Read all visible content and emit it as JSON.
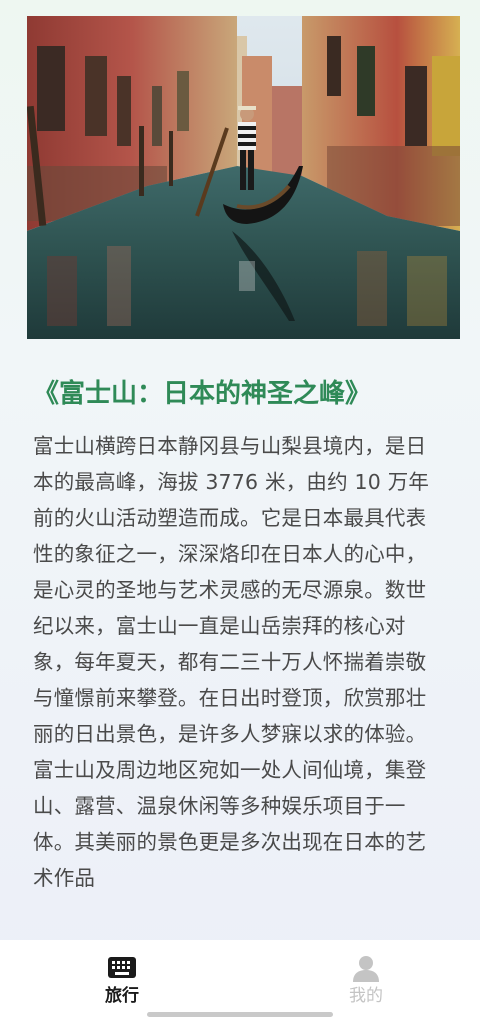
{
  "article": {
    "image_alt": "Venice canal with gondolier",
    "title": "《富士山：日本的神圣之峰》",
    "body": "富士山横跨日本静冈县与山梨县境内，是日本的最高峰，海拔 3776 米，由约 10 万年前的火山活动塑造而成。它是日本最具代表性的象征之一，深深烙印在日本人的心中，是心灵的圣地与艺术灵感的无尽源泉。数世纪以来，富士山一直是山岳崇拜的核心对象，每年夏天，都有二三十万人怀揣着崇敬与憧憬前来攀登。在日出时登顶，欣赏那壮丽的日出景色，是许多人梦寐以求的体验。富士山及周边地区宛如一处人间仙境，集登山、露营、温泉休闲等多种娱乐项目于一体。其美丽的景色更是多次出现在日本的艺术作品"
  },
  "tabbar": {
    "tabs": [
      {
        "label": "旅行",
        "icon": "keyboard-icon",
        "active": true
      },
      {
        "label": "我的",
        "icon": "person-icon",
        "active": false
      }
    ]
  },
  "colors": {
    "title": "#2f8a57",
    "text": "#4a4a4a",
    "tab_active": "#1a1a1a",
    "tab_inactive": "#c4c4c4"
  }
}
